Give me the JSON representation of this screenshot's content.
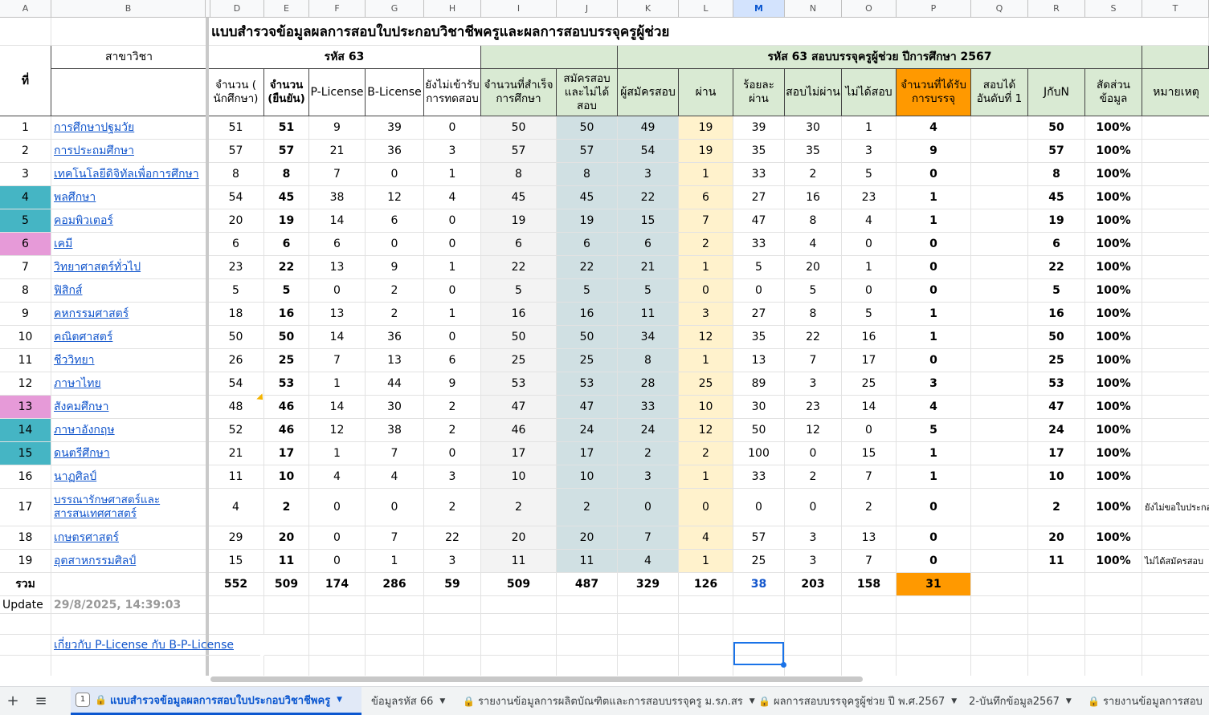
{
  "column_letters": [
    "A",
    "B",
    "",
    "D",
    "E",
    "F",
    "G",
    "H",
    "I",
    "J",
    "K",
    "L",
    "M",
    "N",
    "O",
    "P",
    "Q",
    "R",
    "S",
    "T"
  ],
  "title": "แบบสำรวจข้อมูลผลการสอบใบประกอบวิชาชีพครูและผลการสอบบรรจุครูผู้ช่วย",
  "headers": {
    "no": "ที่",
    "subject": "สาขาวิชา",
    "group1": "รหัส 63",
    "group2": "รหัส 63 สอบบรรจุครูผู้ช่วย ปีการศึกษา 2567",
    "cols": [
      "จำนวน ( นักศึกษา)",
      "จำนวน (ยืนยัน)",
      "P-License",
      "B-License",
      "ยังไม่เข้ารับการทดสอบ",
      "จำนวนที่สำเร็จการศึกษา",
      "สมัครสอบและไม่ได้สอบ",
      "ผู้สมัครสอบ",
      "ผ่าน",
      "ร้อยละผ่าน",
      "สอบไม่ผ่าน",
      "ไม่ได้สอบ",
      "จำนวนที่ได้รับการบรรจุ",
      "สอบได้อันดับที่ 1",
      "JกับN",
      "สัดส่วนข้อมูล",
      "หมายเหตุ"
    ]
  },
  "rows": [
    {
      "no": "1",
      "subject": "การศึกษาปฐมวัย",
      "v": [
        "51",
        "51",
        "9",
        "39",
        "0",
        "50",
        "50",
        "49",
        "19",
        "39",
        "30",
        "1",
        "4",
        "",
        "50",
        "100%",
        ""
      ]
    },
    {
      "no": "2",
      "subject": "การประถมศึกษา",
      "v": [
        "57",
        "57",
        "21",
        "36",
        "3",
        "57",
        "57",
        "54",
        "19",
        "35",
        "35",
        "3",
        "9",
        "",
        "57",
        "100%",
        ""
      ]
    },
    {
      "no": "3",
      "subject": "เทคโนโลยีดิจิทัลเพื่อการศึกษา",
      "v": [
        "8",
        "8",
        "7",
        "0",
        "1",
        "8",
        "8",
        "3",
        "1",
        "33",
        "2",
        "5",
        "0",
        "",
        "8",
        "100%",
        ""
      ]
    },
    {
      "no": "4",
      "subject": "พลศึกษา",
      "v": [
        "54",
        "45",
        "38",
        "12",
        "4",
        "45",
        "45",
        "22",
        "6",
        "27",
        "16",
        "23",
        "1",
        "",
        "45",
        "100%",
        ""
      ]
    },
    {
      "no": "5",
      "subject": "คอมพิวเตอร์",
      "v": [
        "20",
        "19",
        "14",
        "6",
        "0",
        "19",
        "19",
        "15",
        "7",
        "47",
        "8",
        "4",
        "1",
        "",
        "19",
        "100%",
        ""
      ]
    },
    {
      "no": "6",
      "subject": "เคมี",
      "v": [
        "6",
        "6",
        "6",
        "0",
        "0",
        "6",
        "6",
        "6",
        "2",
        "33",
        "4",
        "0",
        "0",
        "",
        "6",
        "100%",
        ""
      ]
    },
    {
      "no": "7",
      "subject": "วิทยาศาสตร์ทั่วไป",
      "v": [
        "23",
        "22",
        "13",
        "9",
        "1",
        "22",
        "22",
        "21",
        "1",
        "5",
        "20",
        "1",
        "0",
        "",
        "22",
        "100%",
        ""
      ]
    },
    {
      "no": "8",
      "subject": "ฟิสิกส์",
      "v": [
        "5",
        "5",
        "0",
        "2",
        "0",
        "5",
        "5",
        "5",
        "0",
        "0",
        "5",
        "0",
        "0",
        "",
        "5",
        "100%",
        ""
      ]
    },
    {
      "no": "9",
      "subject": "คหกรรมศาสตร์",
      "v": [
        "18",
        "16",
        "13",
        "2",
        "1",
        "16",
        "16",
        "11",
        "3",
        "27",
        "8",
        "5",
        "1",
        "",
        "16",
        "100%",
        ""
      ]
    },
    {
      "no": "10",
      "subject": "คณิตศาสตร์",
      "v": [
        "50",
        "50",
        "14",
        "36",
        "0",
        "50",
        "50",
        "34",
        "12",
        "35",
        "22",
        "16",
        "1",
        "",
        "50",
        "100%",
        ""
      ]
    },
    {
      "no": "11",
      "subject": "ชีววิทยา",
      "v": [
        "26",
        "25",
        "7",
        "13",
        "6",
        "25",
        "25",
        "8",
        "1",
        "13",
        "7",
        "17",
        "0",
        "",
        "25",
        "100%",
        ""
      ]
    },
    {
      "no": "12",
      "subject": "ภาษาไทย",
      "v": [
        "54",
        "53",
        "1",
        "44",
        "9",
        "53",
        "53",
        "28",
        "25",
        "89",
        "3",
        "25",
        "3",
        "",
        "53",
        "100%",
        ""
      ]
    },
    {
      "no": "13",
      "subject": "สังคมศึกษา",
      "v": [
        "48",
        "46",
        "14",
        "30",
        "2",
        "47",
        "47",
        "33",
        "10",
        "30",
        "23",
        "14",
        "4",
        "",
        "47",
        "100%",
        ""
      ]
    },
    {
      "no": "14",
      "subject": "ภาษาอังกฤษ",
      "v": [
        "52",
        "46",
        "12",
        "38",
        "2",
        "46",
        "24",
        "24",
        "12",
        "50",
        "12",
        "0",
        "5",
        "",
        "24",
        "100%",
        ""
      ]
    },
    {
      "no": "15",
      "subject": "ดนตรีศึกษา",
      "v": [
        "21",
        "17",
        "1",
        "7",
        "0",
        "17",
        "17",
        "2",
        "2",
        "100",
        "0",
        "15",
        "1",
        "",
        "17",
        "100%",
        ""
      ]
    },
    {
      "no": "16",
      "subject": "นาฏศิลป์",
      "v": [
        "11",
        "10",
        "4",
        "4",
        "3",
        "10",
        "10",
        "3",
        "1",
        "33",
        "2",
        "7",
        "1",
        "",
        "10",
        "100%",
        ""
      ]
    },
    {
      "no": "17",
      "subject": "บรรณารักษศาสตร์และสารสนเทศศาสตร์",
      "v": [
        "4",
        "2",
        "0",
        "0",
        "2",
        "2",
        "2",
        "0",
        "0",
        "0",
        "0",
        "2",
        "0",
        "",
        "2",
        "100%",
        "ยังไม่ขอใบประกอบ"
      ]
    },
    {
      "no": "18",
      "subject": "เกษตรศาสตร์",
      "v": [
        "29",
        "20",
        "0",
        "7",
        "22",
        "20",
        "20",
        "7",
        "4",
        "57",
        "3",
        "13",
        "0",
        "",
        "20",
        "100%",
        ""
      ]
    },
    {
      "no": "19",
      "subject": "อุตสาหกรรมศิลป์",
      "v": [
        "15",
        "11",
        "0",
        "1",
        "3",
        "11",
        "11",
        "4",
        "1",
        "25",
        "3",
        "7",
        "0",
        "",
        "11",
        "100%",
        "ไม่ได้สมัครสอบ"
      ]
    }
  ],
  "total": {
    "label": "รวม",
    "v": [
      "552",
      "509",
      "174",
      "286",
      "59",
      "509",
      "487",
      "329",
      "126",
      "38",
      "203",
      "158",
      "31",
      "",
      "",
      "",
      ""
    ]
  },
  "update": {
    "label": "Update",
    "value": "29/8/2025, 14:39:03"
  },
  "link_text": "เกี่ยวกับ P-License กับ B-P-License",
  "colors": {
    "teal": "#45b5c4",
    "pink": "#e69ad8",
    "orange": "#ff9900",
    "green": "#d9ead3",
    "blue": "#d0e0e3",
    "yellow": "#fff2cc",
    "link": "#1155cc"
  },
  "tabs": {
    "add": "+",
    "menu": "≡",
    "active_num": "1",
    "items": [
      "แบบสำรวจข้อมูลผลการสอบใบประกอบวิชาชีพครู",
      "ข้อมูลรหัส 66",
      "รายงานข้อมูลการผลิตบัณฑิตและการสอบบรรจุครู ม.รภ.สร",
      "ผลการสอบบรรจุครูผู้ช่วย ปี พ.ศ.2567",
      "2-บันทึกข้อมูล2567",
      "รายงานข้อมูลการสอบ"
    ]
  }
}
